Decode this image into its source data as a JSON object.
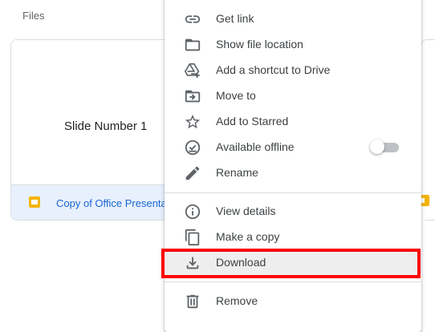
{
  "files_section": {
    "title": "Files"
  },
  "file_card": {
    "thumbnail_text": "Slide Number 1",
    "name": "Copy of Office Presenta",
    "icon": "slides-icon",
    "accent_color": "#f4b400",
    "selected": true
  },
  "context_menu": {
    "items": [
      {
        "label": "Get link",
        "icon": "link-icon"
      },
      {
        "label": "Show file location",
        "icon": "folder-icon"
      },
      {
        "label": "Add a shortcut to Drive",
        "icon": "add-shortcut-icon"
      },
      {
        "label": "Move to",
        "icon": "move-to-icon"
      },
      {
        "label": "Add to Starred",
        "icon": "star-icon"
      },
      {
        "label": "Available offline",
        "icon": "offline-icon",
        "toggle_on": false
      },
      {
        "label": "Rename",
        "icon": "pencil-icon"
      },
      {
        "label": "View details",
        "icon": "info-icon"
      },
      {
        "label": "Make a copy",
        "icon": "copy-icon"
      },
      {
        "label": "Download",
        "icon": "download-icon",
        "highlighted": true
      },
      {
        "label": "Remove",
        "icon": "trash-icon"
      }
    ]
  },
  "annotation": {
    "highlight_color": "#ff0000",
    "highlighted_item": "Download"
  }
}
